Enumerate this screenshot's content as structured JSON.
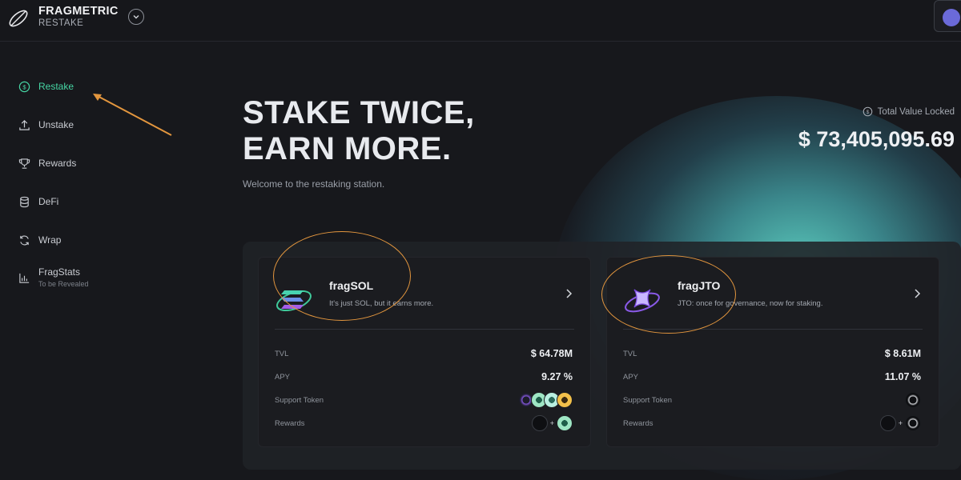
{
  "header": {
    "brand_name": "FRAGMETRIC",
    "brand_sub": "RESTAKE"
  },
  "sidebar": {
    "items": [
      {
        "label": "Restake",
        "icon": "dollar-circle-icon",
        "active": true
      },
      {
        "label": "Unstake",
        "icon": "upload-icon",
        "active": false
      },
      {
        "label": "Rewards",
        "icon": "trophy-icon",
        "active": false
      },
      {
        "label": "DeFi",
        "icon": "database-icon",
        "active": false
      },
      {
        "label": "Wrap",
        "icon": "refresh-icon",
        "active": false
      },
      {
        "label": "FragStats",
        "sub": "To be Revealed",
        "icon": "bar-chart-icon",
        "active": false
      }
    ]
  },
  "hero": {
    "title_line1": "STAKE TWICE,",
    "title_line2": "EARN MORE.",
    "subtitle": "Welcome to the restaking station."
  },
  "tvl": {
    "label": "Total Value Locked",
    "value": "$ 73,405,095.69"
  },
  "cards": [
    {
      "name": "fragSOL",
      "desc": "It's just SOL, but it earns more.",
      "tvl_label": "TVL",
      "tvl": "$ 64.78M",
      "apy_label": "APY",
      "apy": "9.27 %",
      "support_label": "Support Token",
      "rewards_label": "Rewards",
      "plus": "+"
    },
    {
      "name": "fragJTO",
      "desc": "JTO: once for governance, now for staking.",
      "tvl_label": "TVL",
      "tvl": "$ 8.61M",
      "apy_label": "APY",
      "apy": "11.07 %",
      "support_label": "Support Token",
      "rewards_label": "Rewards",
      "plus": "+"
    }
  ],
  "colors": {
    "accent": "#46d6a4",
    "annotation": "#e3963e",
    "background": "#17181c"
  }
}
